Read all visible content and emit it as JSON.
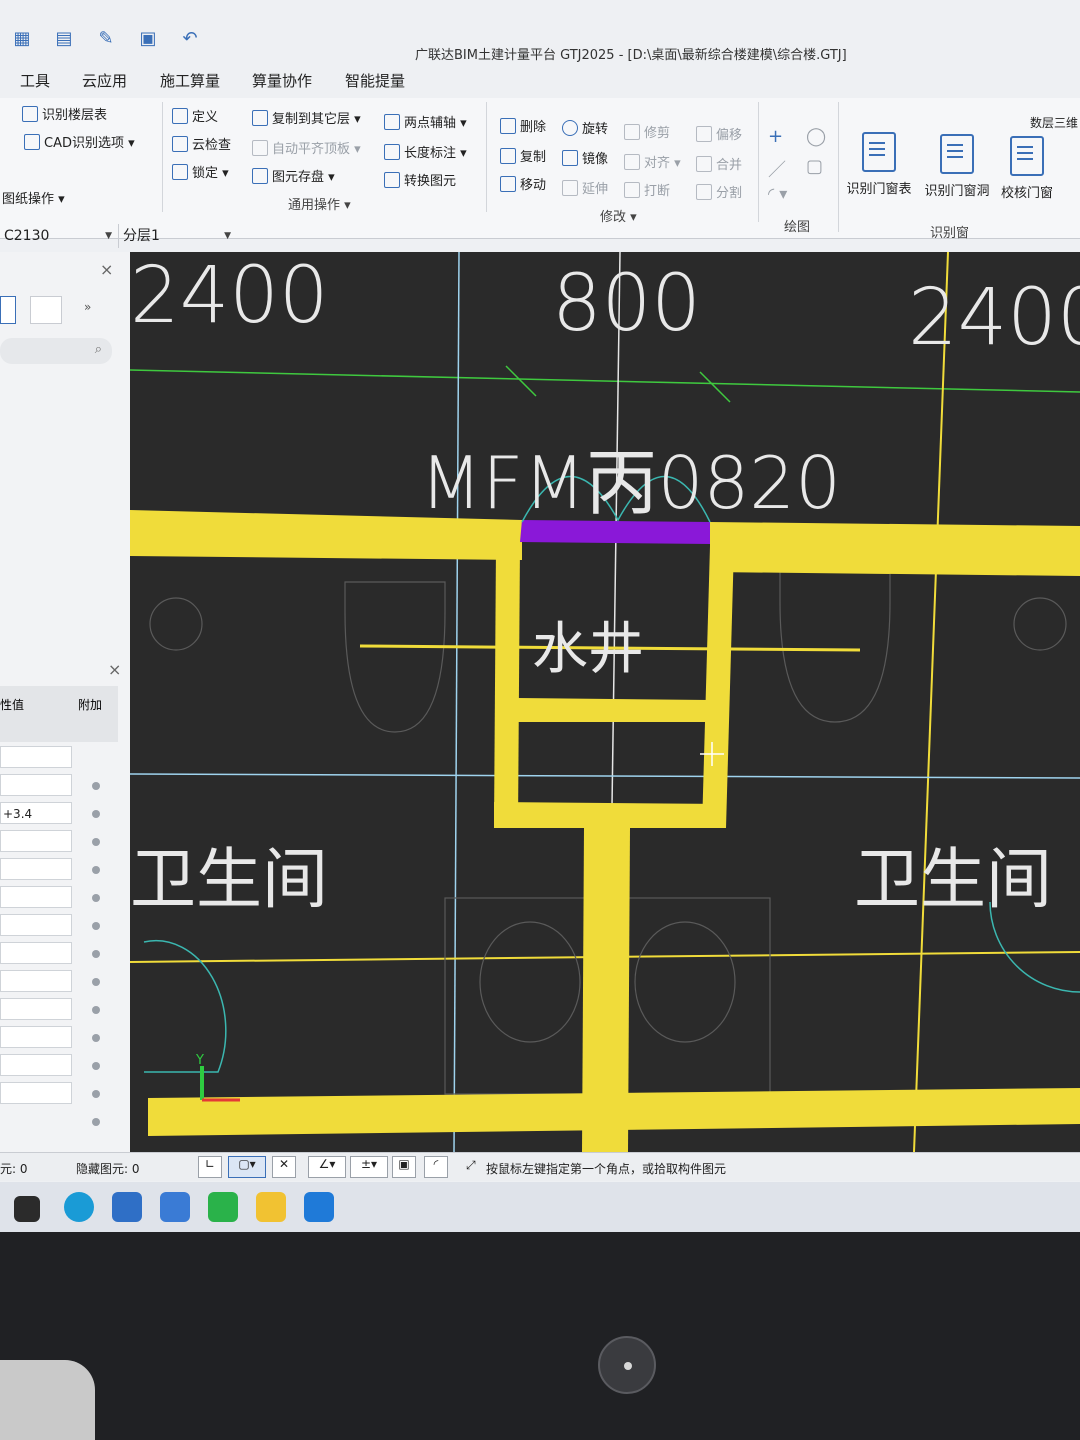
{
  "app": {
    "title": "广联达BIM土建计量平台 GTJ2025 - [D:\\桌面\\最新综合楼建模\\综合楼.GTJ]"
  },
  "quick_access": [
    "grid-icon",
    "layer-icon",
    "pen-icon",
    "save-icon",
    "undo-icon"
  ],
  "menu": [
    "工具",
    "云应用",
    "施工算量",
    "算量协作",
    "智能提量"
  ],
  "ribbon": {
    "left_items": [
      "识别楼层表",
      "CAD识别选项",
      "图纸操作"
    ],
    "general": {
      "items": [
        "定义",
        "复制到其它层",
        "两点辅轴",
        "云检查",
        "自动平齐顶板",
        "长度标注",
        "锁定",
        "图元存盘",
        "转换图元"
      ],
      "label": "通用操作"
    },
    "modify": {
      "items": [
        "删除",
        "旋转",
        "修剪",
        "偏移",
        "复制",
        "镜像",
        "对齐",
        "合并",
        "移动",
        "延伸",
        "打断",
        "分割"
      ],
      "label": "修改"
    },
    "draw_label": "绘图",
    "recognize": {
      "buttons": [
        "识别门窗表",
        "识别门窗洞",
        "校核门窗"
      ],
      "label": "识别窗",
      "top_right": "数层三维"
    }
  },
  "selectors": {
    "component": "C2130",
    "layer": "分层1"
  },
  "props_panel": {
    "col_value": "性值",
    "col_extra": "附加",
    "row_value": "+3.4"
  },
  "canvas": {
    "dim_left": "2400",
    "dim_mid": "800",
    "dim_right": "2400",
    "door_label": "MFM丙0820",
    "shaft_label": "水井",
    "room_left": "卫生间",
    "room_right": "卫生间",
    "axis_y": "Y"
  },
  "status": {
    "count_label": "元: 0",
    "hidden_label": "隐藏图元: 0",
    "hint": "按鼠标左键指定第一个角点，或拾取构件图元"
  },
  "colors": {
    "wall": "#f0dc3a",
    "door": "#8a18d8",
    "grid_green": "#3fc93f",
    "axis_blue": "#9fd3ee",
    "canvas_bg": "#2a2a2a",
    "cad_text": "#e8e8e8"
  }
}
